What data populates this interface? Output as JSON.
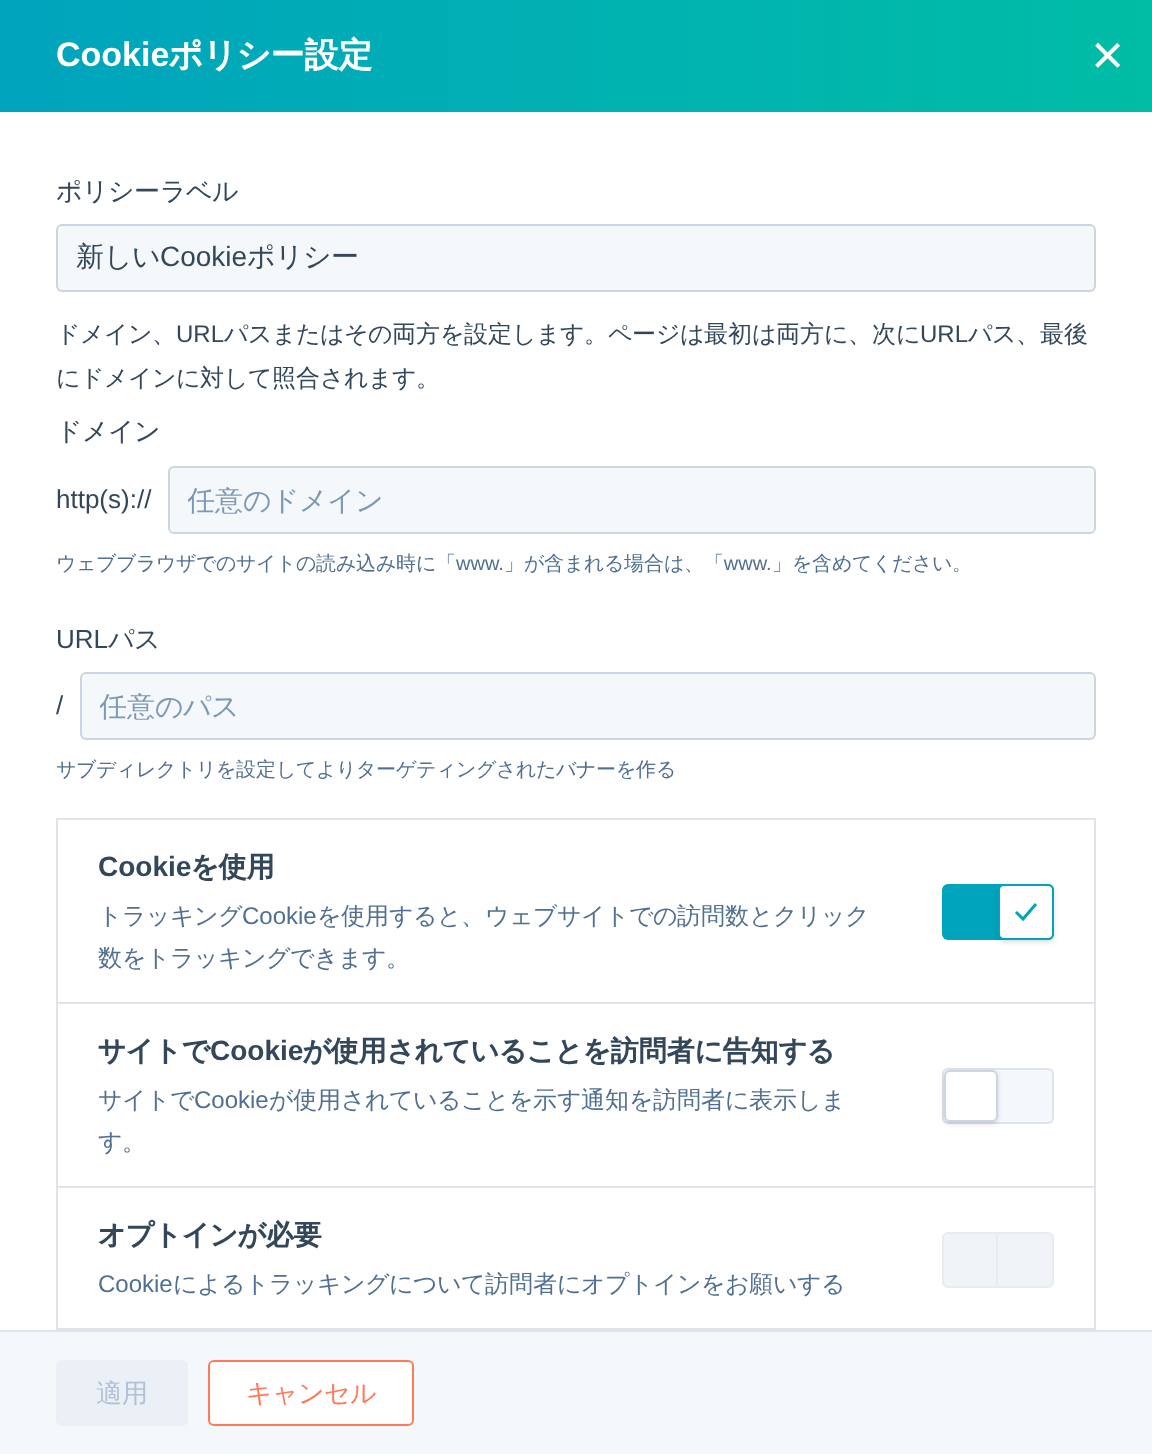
{
  "header": {
    "title": "Cookieポリシー設定",
    "close": "×"
  },
  "policy_label": {
    "label": "ポリシーラベル",
    "value": "新しいCookieポリシー"
  },
  "intro": "ドメイン、URLパスまたはその両方を設定します。ページは最初は両方に、次にURLパス、最後にドメインに対して照合されます。",
  "domain": {
    "label": "ドメイン",
    "prefix": "http(s)://",
    "placeholder": "任意のドメイン",
    "hint": "ウェブブラウザでのサイトの読み込み時に「www.」が含まれる場合は、「www.」を含めてください。"
  },
  "path": {
    "label": "URLパス",
    "prefix": "/",
    "placeholder": "任意のパス",
    "hint": "サブディレクトリを設定してよりターゲティングされたバナーを作る"
  },
  "settings": [
    {
      "title": "Cookieを使用",
      "description": "トラッキングCookieを使用すると、ウェブサイトでの訪問数とクリック数をトラッキングできます。",
      "on": true,
      "disabled": false
    },
    {
      "title": "サイトでCookieが使用されていることを訪問者に告知する",
      "description": "サイトでCookieが使用されていることを示す通知を訪問者に表示します。",
      "on": false,
      "disabled": false
    },
    {
      "title": "オプトインが必要",
      "description": "Cookieによるトラッキングについて訪問者にオプトインをお願いする",
      "on": false,
      "disabled": true
    }
  ],
  "footer": {
    "apply": {
      "label": "適用",
      "disabled": true
    },
    "cancel": "キャンセル"
  }
}
